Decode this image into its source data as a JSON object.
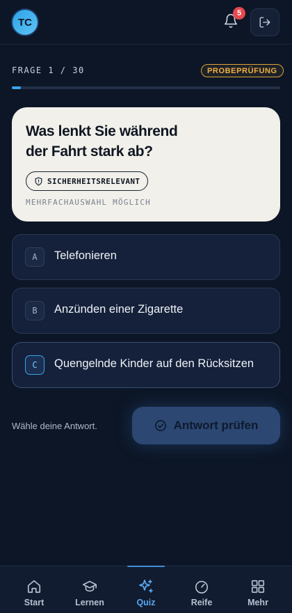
{
  "header": {
    "avatar_initials": "TC",
    "notification_count": "5"
  },
  "quiz": {
    "progress_label": "FRAGE 1 / 30",
    "mode_label": "PROBEPRÜFUNG",
    "progress_fraction": 0.033,
    "question": "Was lenkt Sie während der Fahrt stark ab?",
    "tag": "SICHERHEITSRELEVANT",
    "hint": "MEHRFACHAUSWAHL MÖGLICH",
    "options": [
      {
        "letter": "A",
        "text": "Telefonieren"
      },
      {
        "letter": "B",
        "text": "Anzünden einer Zigarette"
      },
      {
        "letter": "C",
        "text": "Quengelnde Kinder auf den Rücksitzen"
      }
    ],
    "choose_prompt": "Wähle deine Antwort.",
    "check_button": "Antwort prüfen"
  },
  "nav": {
    "items": [
      {
        "label": "Start",
        "icon": "home-icon"
      },
      {
        "label": "Lernen",
        "icon": "graduation-cap-icon"
      },
      {
        "label": "Quiz",
        "icon": "sparkles-icon"
      },
      {
        "label": "Reife",
        "icon": "gauge-icon"
      },
      {
        "label": "Mehr",
        "icon": "grid-icon"
      }
    ],
    "active": "Quiz"
  },
  "colors": {
    "background": "#0c1626",
    "accent": "#3aa3e8",
    "warning": "#f0b040",
    "badge": "#e5484d"
  }
}
